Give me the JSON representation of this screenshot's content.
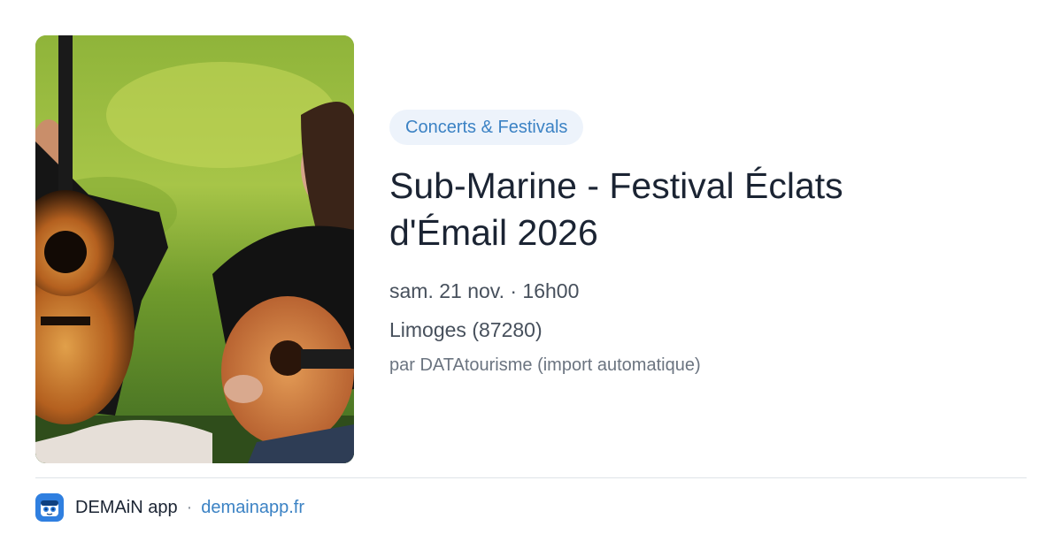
{
  "event": {
    "category": "Concerts & Festivals",
    "title": "Sub-Marine - Festival Éclats d'Émail 2026",
    "date_time": "sam. 21 nov. · 16h00",
    "location": "Limoges (87280)",
    "source": "par DATAtourisme (import automatique)"
  },
  "footer": {
    "app_name": "DEMAiN app",
    "separator": "·",
    "domain": "demainapp.fr"
  },
  "colors": {
    "accent": "#3b82c4",
    "badge_background": "#edf3fb",
    "title": "#1b2433",
    "app_icon": "#2f7fe0"
  },
  "icons": {
    "app": "demain-app-icon"
  }
}
